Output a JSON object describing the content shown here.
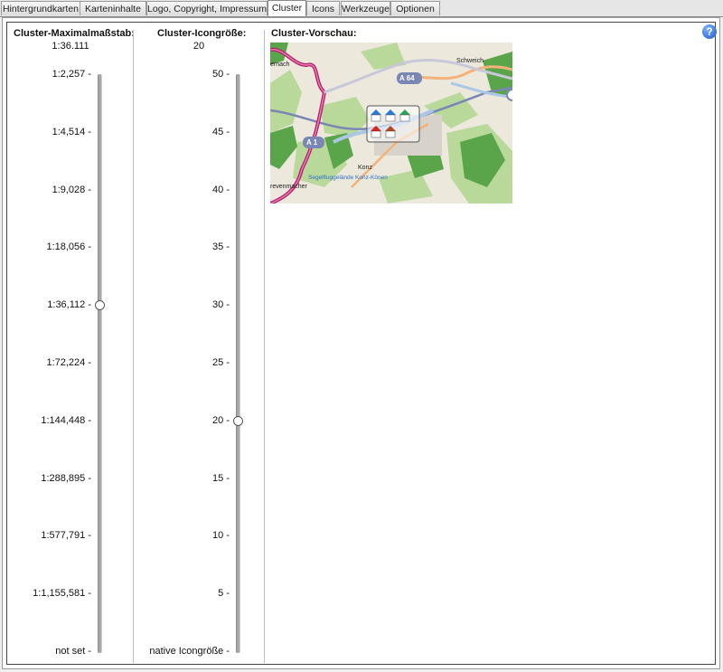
{
  "tabs": [
    {
      "label": "Hintergrundkarten",
      "active": false
    },
    {
      "label": "Karteninhalte",
      "active": false
    },
    {
      "label": "Logo, Copyright, Impressum",
      "active": false
    },
    {
      "label": "Cluster",
      "active": true
    },
    {
      "label": "Icons",
      "active": false
    },
    {
      "label": "Werkzeuge",
      "active": false
    },
    {
      "label": "Optionen",
      "active": false
    }
  ],
  "max_scale": {
    "title": "Cluster-Maximalmaßstab:",
    "current": "1:36.111",
    "ticks": [
      "1:2,257 -",
      "1:4,514 -",
      "1:9,028 -",
      "1:18,056 -",
      "1:36,112 -",
      "1:72,224 -",
      "1:144,448 -",
      "1:288,895 -",
      "1:577,791 -",
      "1:1,155,581 -",
      "not set -"
    ],
    "selected_index": 4
  },
  "icon_size": {
    "title": "Cluster-Icongröße:",
    "current": "20",
    "ticks": [
      "50 -",
      "45 -",
      "40 -",
      "35 -",
      "30 -",
      "25 -",
      "20 -",
      "15 -",
      "10 -",
      "5 -",
      "native Icongröße -"
    ],
    "selected_index": 6
  },
  "preview": {
    "title": "Cluster-Vorschau:",
    "map_labels": {
      "top_left": "ernach",
      "schweich": "Schweich",
      "a64": "A 64",
      "a1": "A 1",
      "konz": "Konz",
      "bottom_left": "revenmacher",
      "airfield": "Segelfluggelände Konz-Könen"
    }
  },
  "help_icon": "?"
}
